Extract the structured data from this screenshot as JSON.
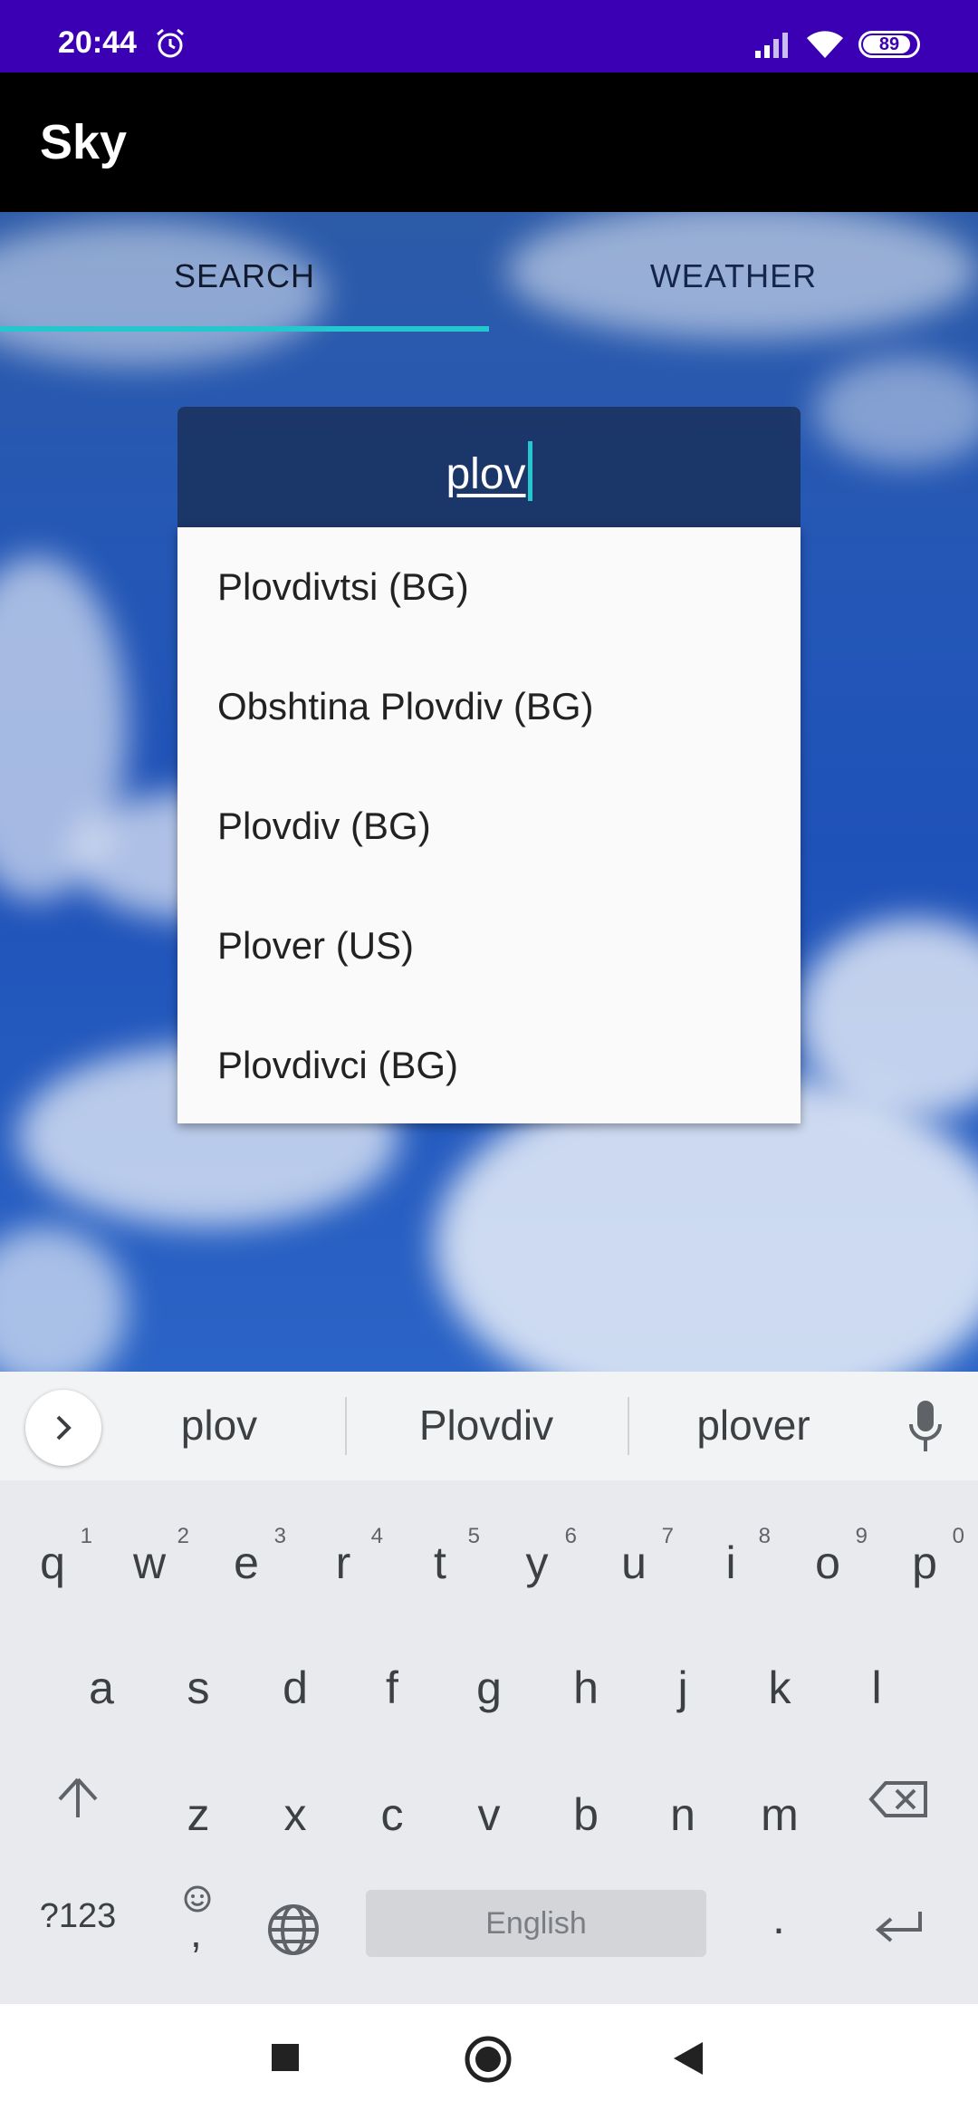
{
  "status_bar": {
    "time": "20:44",
    "battery": "89",
    "battery_level_percent": 89
  },
  "app_bar": {
    "title": "Sky"
  },
  "tabs": [
    {
      "label": "SEARCH",
      "selected": true
    },
    {
      "label": "WEATHER",
      "selected": false
    }
  ],
  "search": {
    "value": "plov"
  },
  "suggestions_dropdown": [
    "Plovdivtsi (BG)",
    "Obshtina Plovdiv (BG)",
    "Plovdiv (BG)",
    "Plover (US)",
    "Plovdivci (BG)"
  ],
  "keyboard": {
    "suggestions": [
      "plov",
      "Plovdiv",
      "plover"
    ],
    "row1": [
      "q",
      "w",
      "e",
      "r",
      "t",
      "y",
      "u",
      "i",
      "o",
      "p"
    ],
    "row1_hints": [
      "1",
      "2",
      "3",
      "4",
      "5",
      "6",
      "7",
      "8",
      "9",
      "0"
    ],
    "row2": [
      "a",
      "s",
      "d",
      "f",
      "g",
      "h",
      "j",
      "k",
      "l"
    ],
    "row3": [
      "z",
      "x",
      "c",
      "v",
      "b",
      "n",
      "m"
    ],
    "symbols_label": "?123",
    "comma_label": ",",
    "space_label": "English",
    "period_label": "."
  },
  "colors": {
    "status_bar": "#3b00b3",
    "accent": "#25c7cf",
    "app_bar": "#000000"
  },
  "icons": [
    "alarm-icon",
    "signal-icon",
    "wifi-icon",
    "mic-icon",
    "shift-icon",
    "backspace-icon",
    "globe-icon",
    "emoji-icon",
    "enter-icon",
    "chevron-right-icon",
    "recents-icon",
    "home-icon",
    "back-icon"
  ]
}
